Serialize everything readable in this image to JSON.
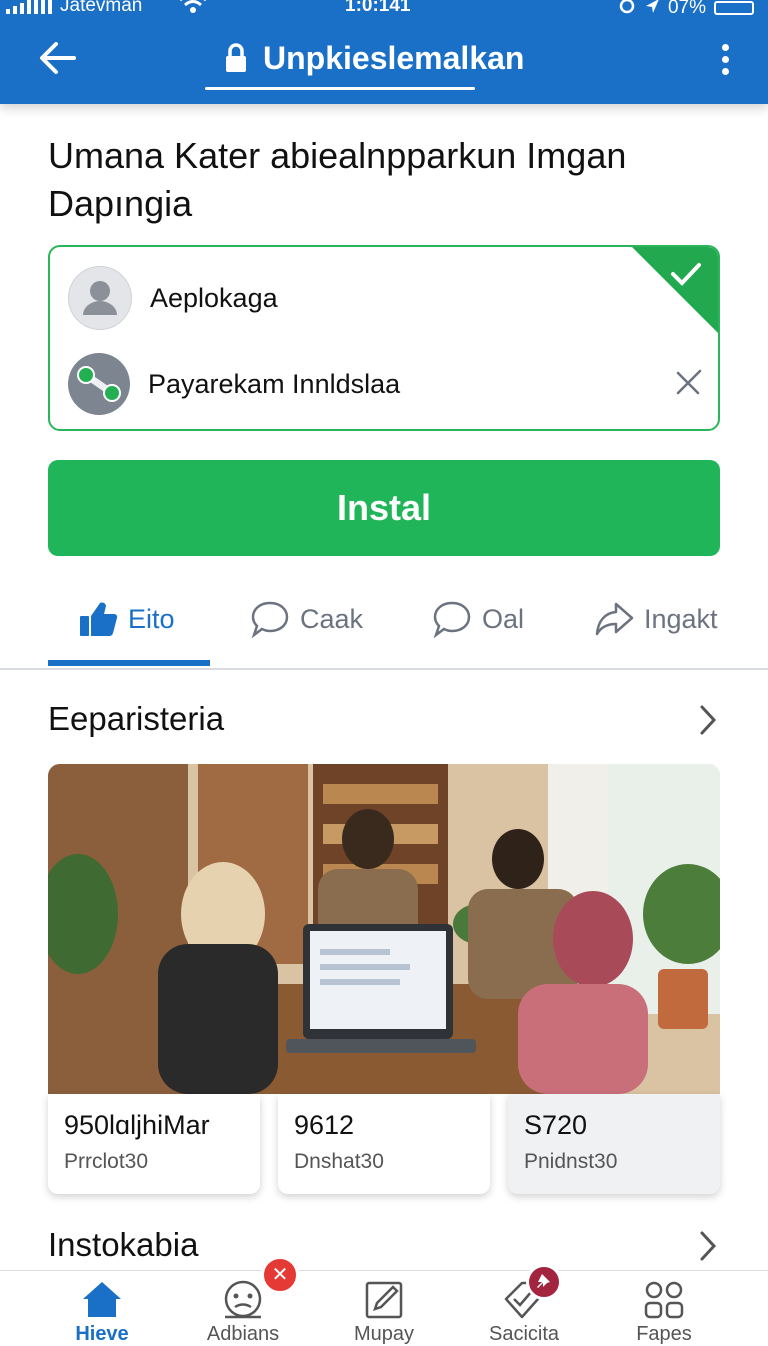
{
  "status_bar": {
    "carrier": "Jatevman",
    "time": "1:0:141",
    "battery": "07%"
  },
  "header": {
    "title": "Unpkieslemalkan",
    "icons": [
      "back-arrow-icon",
      "lock-icon",
      "more-vertical-icon"
    ]
  },
  "heading": "Umana Kater abiealnpparkun Imgan Dapıngia",
  "options": [
    {
      "label": "Aeplokaga",
      "icon": "user-avatar-icon",
      "state": "selected"
    },
    {
      "label": "Payarekam Innldslaa",
      "icon": "share-icon",
      "state": "dismiss"
    }
  ],
  "install_label": "Instal",
  "tabs": [
    {
      "label": "Eito",
      "icon": "thumbs-up-icon",
      "active": true
    },
    {
      "label": "Caak",
      "icon": "chat-bubble-icon",
      "active": false
    },
    {
      "label": "Oal",
      "icon": "chat-bubble-icon",
      "active": false
    },
    {
      "label": "Ingakt",
      "icon": "share-arrow-icon",
      "active": false
    }
  ],
  "section1": {
    "title": "Eeparisteria"
  },
  "stats": [
    {
      "value": "950lɑljhiMar",
      "label": "Prrclot30"
    },
    {
      "value": "9612",
      "label": "Dnshat30"
    },
    {
      "value": "S720",
      "label": "Pnidnst30"
    }
  ],
  "section2": {
    "title": "Instokabia"
  },
  "bottom_nav": [
    {
      "label": "Hieve",
      "icon": "home-icon",
      "active": true
    },
    {
      "label": "Adbians",
      "icon": "face-icon",
      "badge_icon": "close-icon"
    },
    {
      "label": "Mupay",
      "icon": "edit-icon"
    },
    {
      "label": "Sacicita",
      "icon": "tag-icon",
      "badge_icon": "pin-icon"
    },
    {
      "label": "Fapes",
      "icon": "grid-icon"
    }
  ],
  "colors": {
    "primary": "#1a6fc7",
    "accent_green": "#21b559",
    "badge_red": "#e53935"
  }
}
